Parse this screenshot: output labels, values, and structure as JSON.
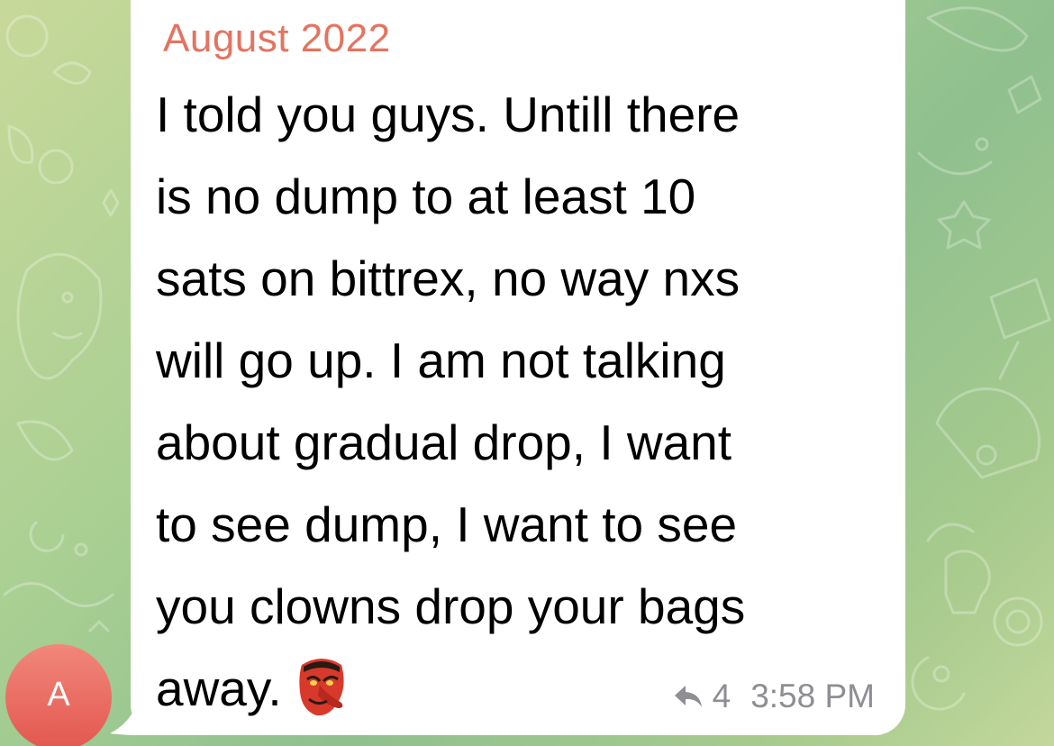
{
  "chat": {
    "avatar": {
      "initial": "A",
      "color_top": "#f2877a",
      "color_bottom": "#e2574f"
    },
    "message": {
      "sender_name": "August 2022",
      "sender_color": "#e5735f",
      "lines": [
        "I told you guys. Untill there",
        "is no dump to at least 10",
        "sats on bittrex, no way nxs",
        "will go up. I am not talking",
        "about gradual drop, I want",
        "to see dump, I want to see",
        "you clowns drop your bags",
        "away."
      ],
      "emoji": "goblin-mask-emoji",
      "forward_icon": "forward-arrow-icon",
      "forward_count": "4",
      "time": "3:58 PM"
    },
    "wallpaper": {
      "pattern": "doodle-pattern",
      "colors": [
        "#c7d99a",
        "#8fc08e"
      ]
    }
  }
}
